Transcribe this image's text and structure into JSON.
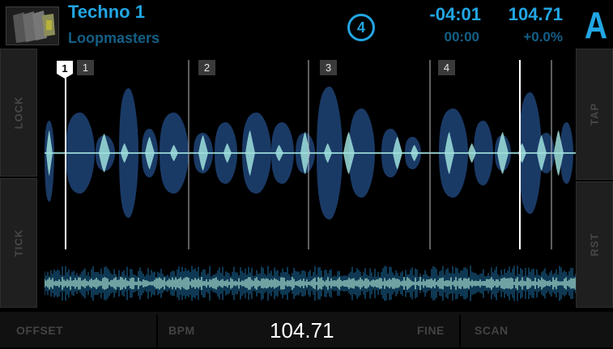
{
  "header": {
    "track_title": "Techno 1",
    "artist": "Loopmasters",
    "beat_count": "4",
    "remaining_time": "-04:01",
    "elapsed_time": "00:00",
    "bpm": "104.71",
    "pitch": "+0.0%",
    "deck": "A",
    "cover_icon": "album-art"
  },
  "side_buttons": {
    "left_top": "LOCK",
    "left_bottom": "TICK",
    "right_top": "TAP",
    "right_bottom": "RST"
  },
  "beat_markers": [
    {
      "label": "1",
      "beat": 1
    },
    {
      "label": "2",
      "beat": 2
    },
    {
      "label": "3",
      "beat": 3
    },
    {
      "label": "4",
      "beat": 4
    }
  ],
  "cue_marker": "1",
  "bottom_bar": {
    "offset_label": "OFFSET",
    "bpm_label": "BPM",
    "bpm_value": "104.71",
    "fine_label": "FINE",
    "scan_label": "SCAN"
  },
  "colors": {
    "accent": "#22a6e3",
    "accent_dim": "#135f86",
    "wave_body": "#1a3a66",
    "wave_core": "#9fe0dd"
  }
}
